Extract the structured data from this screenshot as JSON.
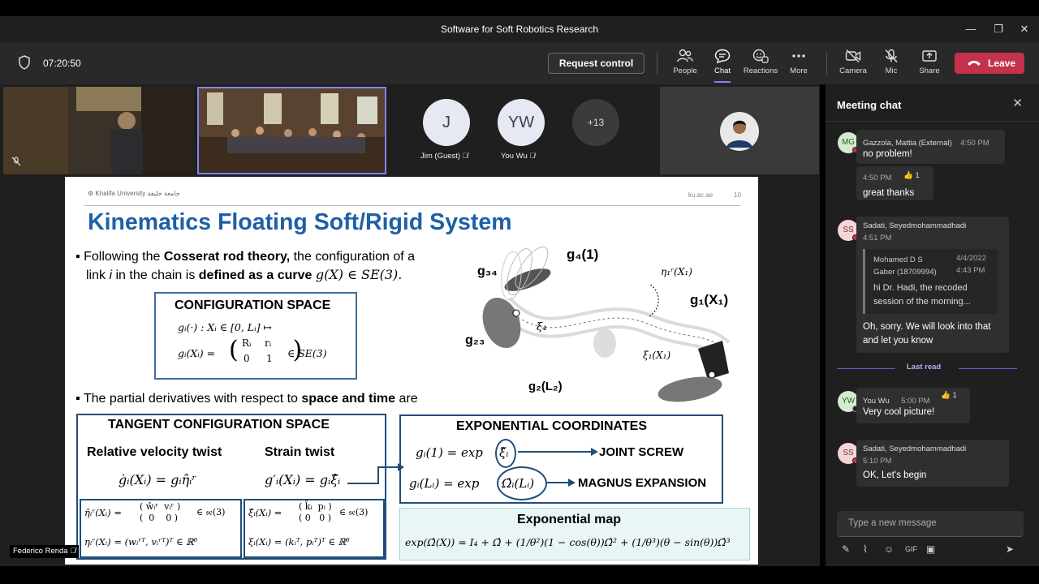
{
  "window": {
    "title": "Software for Soft Robotics Research"
  },
  "toolbar": {
    "timer": "07:20:50",
    "request_control": "Request control",
    "people": "People",
    "chat": "Chat",
    "reactions": "Reactions",
    "more": "More",
    "camera": "Camera",
    "mic": "Mic",
    "share": "Share",
    "leave": "Leave"
  },
  "participants": {
    "p1_name": "Jim (Guest)",
    "p1_initials": "J",
    "p2_name": "You Wu",
    "p2_initials": "YW",
    "overflow": "+13",
    "presenter_name": "Federico Renda"
  },
  "slide": {
    "logo_text": "Khalifa University",
    "logo_arabic": "جامعة خليفة",
    "site": "ku.ac.ae",
    "page": "10",
    "title": "Kinematics Floating Soft/Rigid System",
    "b1_pre": "Following the",
    "b1_bold1": "Cosserat rod theory,",
    "b1_mid": "the configuration of a",
    "b1_line2a": "link",
    "b1_i": "i",
    "b1_line2b": "in the chain is",
    "b1_bold2": "defined as a curve",
    "b1_math": "g(X) ∈ SE(3).",
    "config_title": "CONFIGURATION SPACE",
    "config_eq1": "gᵢ(·) : Xᵢ ∈ [0, Lᵢ] ↦",
    "config_eq2_left": "gᵢ(Xᵢ) =",
    "config_eq2_right": "∈ SE(3)",
    "matrix_r": "Rᵢ",
    "matrix_rv": "rᵢ",
    "matrix_0": "0",
    "matrix_1": "1",
    "b2_pre": "The partial derivatives with respect to",
    "b2_bold": "space and time",
    "b2_post": "are",
    "tangent_title": "TANGENT CONFIGURATION SPACE",
    "rel_vel": "Relative velocity twist",
    "strain": "Strain twist",
    "eq_vel": "ġᵢ(Xᵢ) = gᵢη̂ᵢʳ",
    "eq_strain": "g′ᵢ(Xᵢ) = gᵢξ̂ᵢ",
    "eta_hat": "η̂ᵢʳ(Xᵢ) =",
    "eta_vec": "ηᵢʳ(Xᵢ) = (wᵢʳᵀ, vᵢʳᵀ)ᵀ ∈ ℝ⁶",
    "xi_hat": "ξ̂ᵢ(Xᵢ) =",
    "xi_vec": "ξᵢ(Xᵢ) = (kᵢᵀ, pᵢᵀ)ᵀ ∈ ℝ⁶",
    "se3": "∈ 𝔰𝔢(3)",
    "exp_title": "EXPONENTIAL COORDINATES",
    "exp_eq1": "gᵢ(1) = exp",
    "exp_xi": "ξ̂ᵢ",
    "joint_screw": "JOINT SCREW",
    "exp_eq2": "gᵢ(Lᵢ) = exp",
    "exp_omega": "Ω̂ᵢ(Lᵢ)",
    "magnus": "MAGNUS EXPANSION",
    "expmap_title": "Exponential map",
    "expmap_eq": "exp(Ω̂(X)) = I₄ + Ω̂ + (1/θ²)(1 − cos(θ))Ω̂² + (1/θ³)(θ − sin(θ))Ω̂³",
    "fig_g4": "g₄(1)",
    "fig_g34": "g₃₄",
    "fig_g23": "g₂₃",
    "fig_g2": "g₂(L₂)",
    "fig_g1": "g₁(X₁)",
    "fig_xi4": "ξ₄",
    "fig_xi1": "ξ₁(X₁)",
    "fig_eta": "η₁ʳ(X₁)"
  },
  "chat": {
    "header": "Meeting chat",
    "messages": [
      {
        "initials": "MG",
        "author": "Gazzola, Mattia (External)",
        "time": "4:50 PM",
        "text": "no problem!"
      },
      {
        "time": "4:50 PM",
        "reaction_count": "1",
        "text": "great thanks"
      },
      {
        "initials": "SS",
        "author": "Sadati, Seyedmohammadhadi",
        "time": "4:51 PM",
        "quote_author": "Mohamed D S Gaber (18709994)",
        "quote_date": "4/4/2022",
        "quote_time": "4:43 PM",
        "quote_text": "hi Dr. Hadi, the recoded session of the morning...",
        "text": "Oh, sorry. We will look into that and let you know"
      },
      {
        "initials": "YW",
        "author": "You Wu",
        "time": "5:00 PM",
        "reaction_count": "1",
        "text": "Very cool picture!"
      },
      {
        "initials": "SS",
        "author": "Sadati, Seyedmohammadhadi",
        "time": "5:10 PM",
        "text": "OK, Let's begin"
      }
    ],
    "last_read": "Last read",
    "compose_placeholder": "Type a new message"
  },
  "colors": {
    "leave": "#c4314b",
    "accent": "#7f85f5",
    "slide_title": "#1f5fa8",
    "box_border": "#1f4e79"
  }
}
